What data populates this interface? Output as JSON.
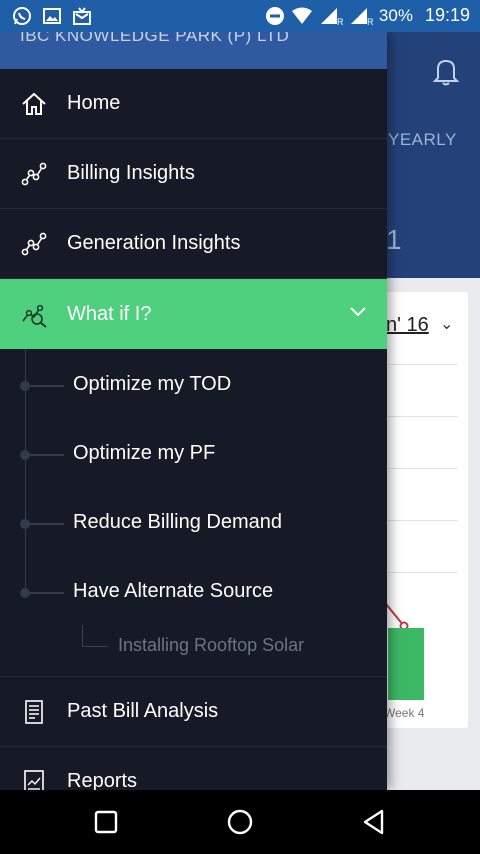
{
  "status_bar": {
    "icons": [
      "whatsapp-icon",
      "gallery-icon",
      "inbox-icon",
      "do-not-disturb-icon",
      "wifi-icon",
      "signal-r-icon",
      "signal-r-icon"
    ],
    "battery": "30%",
    "time": "19:19"
  },
  "background_screen": {
    "tab_label": "YEARLY",
    "month_selector": "n' 16",
    "week_label": "Week 4",
    "bracket_glyph": "1",
    "colors": {
      "header": "#24427a",
      "bar": "#3cb865"
    }
  },
  "drawer": {
    "company_name": "IBC KNOWLEDGE PARK (P) LTD",
    "items": [
      {
        "label": "Home",
        "icon": "home-icon"
      },
      {
        "label": "Billing Insights",
        "icon": "graph-nodes-icon"
      },
      {
        "label": "Generation Insights",
        "icon": "graph-nodes-icon"
      },
      {
        "label": "What if I?",
        "icon": "whatif-chart-icon",
        "expanded": true
      }
    ],
    "sub_items": [
      {
        "label": "Optimize my TOD"
      },
      {
        "label": "Optimize my PF"
      },
      {
        "label": "Reduce Billing Demand"
      },
      {
        "label": "Have Alternate Source"
      }
    ],
    "sub_sub_items": [
      {
        "label": "Installing Rooftop Solar"
      }
    ],
    "bottom_items": [
      {
        "label": "Past Bill Analysis",
        "icon": "bill-document-icon"
      },
      {
        "label": "Reports",
        "icon": "report-chart-icon"
      }
    ],
    "colors": {
      "background": "#161a27",
      "active": "#4fd07e",
      "header": "#2f5aa0"
    }
  },
  "nav_bar": {
    "buttons": [
      "recent-apps-icon",
      "home-circle-icon",
      "back-triangle-icon"
    ]
  }
}
